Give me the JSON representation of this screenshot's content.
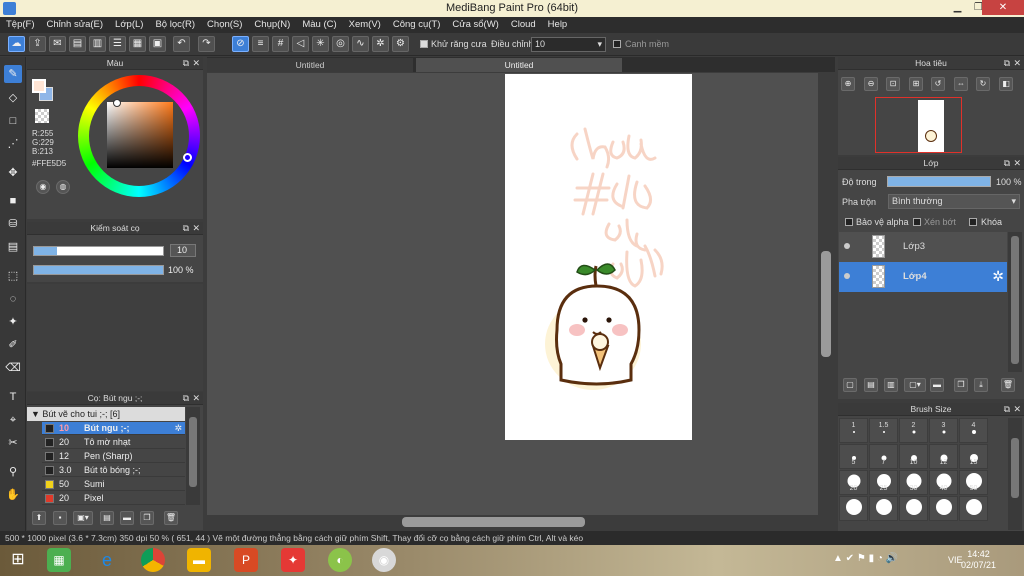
{
  "window": {
    "title": "MediBang Paint Pro (64bit)",
    "min": "▁",
    "max": "❐",
    "close": "✕"
  },
  "menu": [
    "Tệp(F)",
    "Chỉnh sửa(E)",
    "Lớp(L)",
    "Bộ lọc(R)",
    "Chọn(S)",
    "Chụp(N)",
    "Màu (C)",
    "Xem(V)",
    "Công cụ(T)",
    "Cửa sổ(W)",
    "Cloud",
    "Help"
  ],
  "toolbar": {
    "antialias_label": "Khử răng cưa",
    "adjust_label": "Điều chỉnh",
    "adjust_value": "10",
    "smooth_label": "Canh mềm"
  },
  "color_panel": {
    "title": "Màu",
    "r": "R:255",
    "g": "G:229",
    "b": "B:213",
    "hex": "#FFE5D5",
    "fg_color": "#ffe5d5"
  },
  "brush_control": {
    "title": "Kiểm soát cọ",
    "size_value": "10",
    "size_fraction": 0.18,
    "opacity_value": "100 %",
    "opacity_fraction": 1.0
  },
  "brush_panel": {
    "title": "Cọ: Bút ngu ;-;",
    "group": "Bút vẽ cho tui ;-; [6]",
    "items": [
      {
        "size": "10",
        "name": "Bút ngu ;-;",
        "color": "#222222"
      },
      {
        "size": "20",
        "name": "Tô mờ nhạt",
        "color": "#222222"
      },
      {
        "size": "12",
        "name": "Pen (Sharp)",
        "color": "#222222"
      },
      {
        "size": "3.0",
        "name": "Bút tô bóng ;-;",
        "color": "#222222"
      },
      {
        "size": "50",
        "name": "Sumi",
        "color": "#f2d21a"
      },
      {
        "size": "20",
        "name": "Pixel",
        "color": "#e03a2a"
      }
    ]
  },
  "canvas": {
    "tabs": [
      "Untitled",
      "Untitled"
    ]
  },
  "navigator": {
    "title": "Hoa tiêu"
  },
  "layers": {
    "title": "Lớp",
    "opacity_label": "Độ trong",
    "opacity_value": "100 %",
    "blend_label": "Pha trộn",
    "blend_value": "Bình thường",
    "protect_alpha": "Bảo vệ alpha",
    "clip": "Xén bớt",
    "lock": "Khóa",
    "items": [
      {
        "name": "Lớp3"
      },
      {
        "name": "Lớp4"
      }
    ]
  },
  "brush_size": {
    "title": "Brush Size",
    "sizes": [
      "1",
      "1.5",
      "2",
      "3",
      "4",
      "5",
      "7",
      "10",
      "12",
      "15",
      "20",
      "25",
      "30",
      "40",
      "50",
      "",
      "",
      "",
      "",
      ""
    ]
  },
  "status": {
    "dims": "500 * 1000 pixel",
    "cm": "(3.6 * 7.3cm)",
    "dpi": "350 dpi",
    "zoom": "50 %",
    "coords": "( 651, 44 )",
    "hint": "Vẽ một đường thẳng bằng cách giữ phím Shift, Thay đổi cỡ cọ bằng cách giữ phím Ctrl, Alt và kéo"
  },
  "taskbar": {
    "lang": "VIE",
    "time": "14:42",
    "date": "02/07/21"
  }
}
